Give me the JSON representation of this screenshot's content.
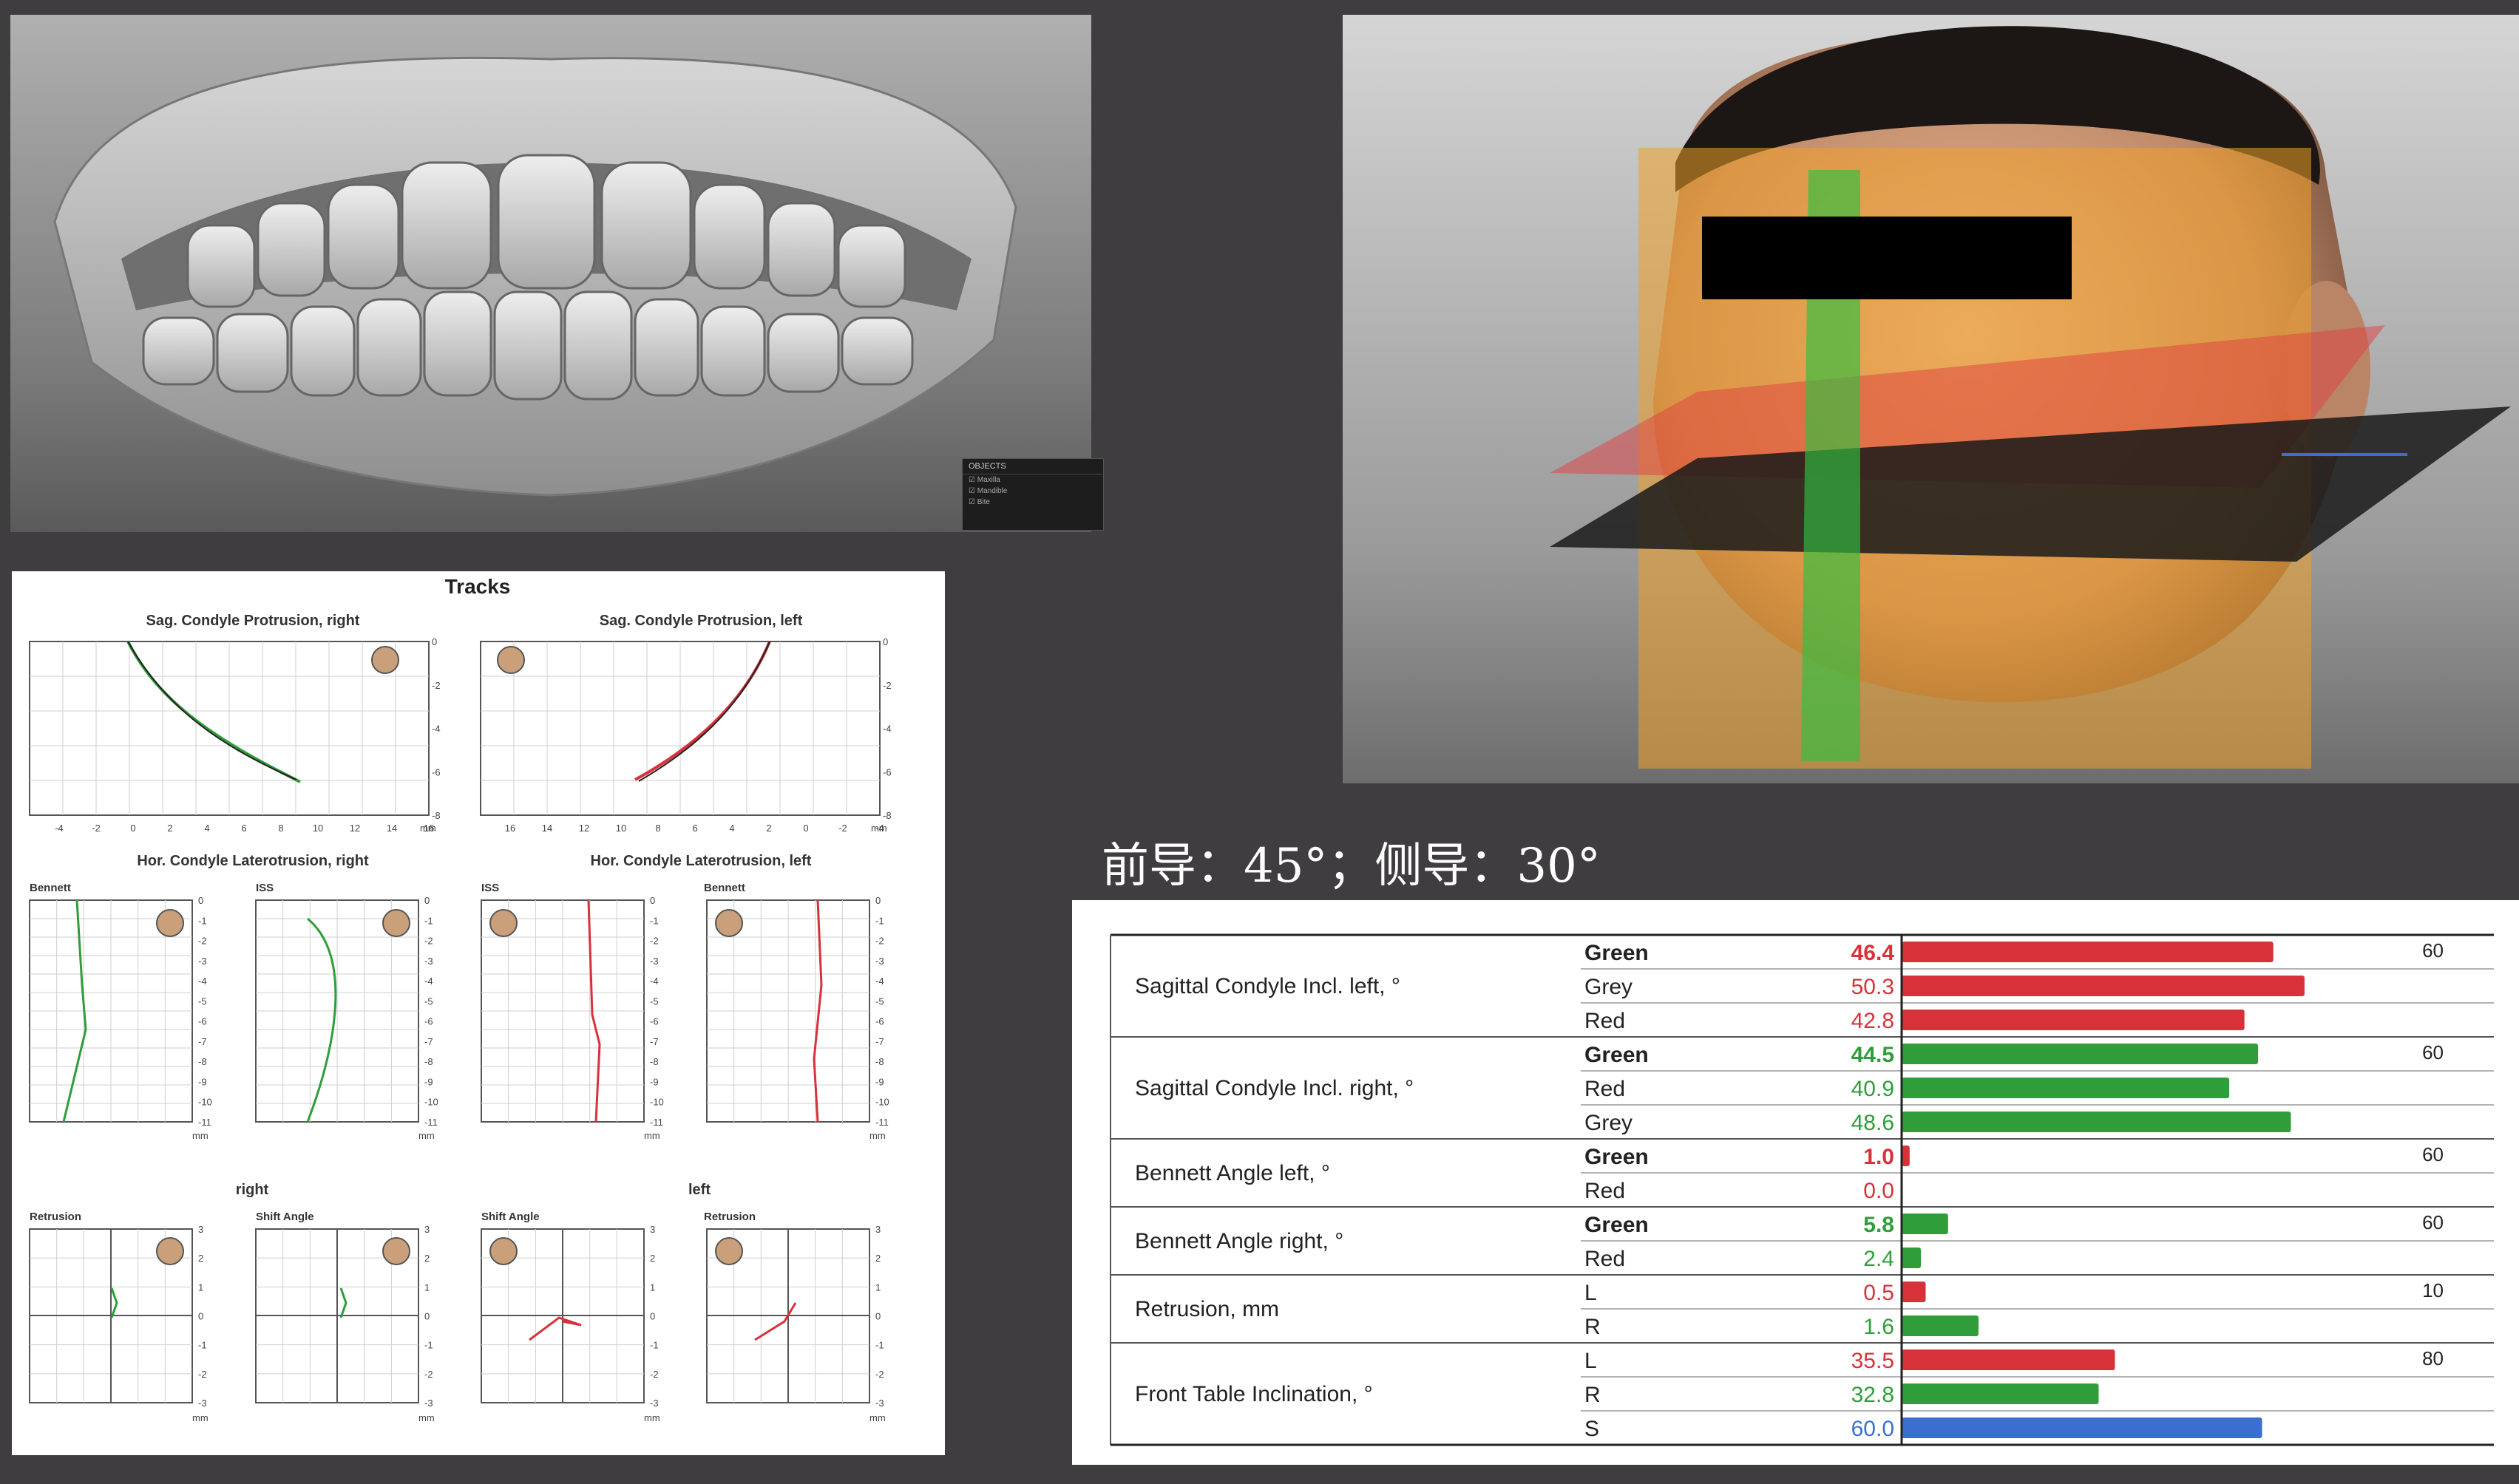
{
  "caption": "前导：45°；侧导：30°",
  "colors": {
    "green": "#2e9d3a",
    "red": "#d7323a",
    "blue": "#3a6fd0",
    "grey_bar": "#d7323a"
  },
  "scene_popup": {
    "title": "OBJECTS",
    "items": [
      "Maxilla",
      "Mandible",
      "Bite"
    ]
  },
  "tracks": {
    "title": "Tracks",
    "sag_right_title": "Sag. Condyle Protrusion, right",
    "sag_left_title": "Sag. Condyle Protrusion, left",
    "sag_right_xticks": [
      "-4",
      "-2",
      "0",
      "2",
      "4",
      "6",
      "8",
      "10",
      "12",
      "14",
      "16"
    ],
    "sag_left_xticks": [
      "16",
      "14",
      "12",
      "10",
      "8",
      "6",
      "4",
      "2",
      "0",
      "-2",
      "-4"
    ],
    "sag_yticks": [
      "0",
      "-2",
      "-4",
      "-6",
      "-8"
    ],
    "unit": "mm",
    "hor_right_title": "Hor. Condyle Laterotrusion, right",
    "hor_left_title": "Hor. Condyle Laterotrusion, left",
    "bennett_label": "Bennett",
    "iss_label": "ISS",
    "hor_yticks": [
      "0",
      "-1",
      "-2",
      "-3",
      "-4",
      "-5",
      "-6",
      "-7",
      "-8",
      "-9",
      "-10",
      "-11"
    ],
    "right_label": "right",
    "left_label": "left",
    "retrusion_label": "Retrusion",
    "shift_label": "Shift Angle",
    "bottom_yticks": [
      "3",
      "2",
      "1",
      "0",
      "-1",
      "-2",
      "-3"
    ]
  },
  "rows": [
    {
      "label": "Sagittal Condyle Incl. left, °",
      "max": "60",
      "scale": 60,
      "entries": [
        {
          "name": "Green",
          "value": "46.4",
          "v": 46.4,
          "text_color": "#d7323a",
          "bar": "#d7323a",
          "bold": true
        },
        {
          "name": "Grey",
          "value": "50.3",
          "v": 50.3,
          "text_color": "#d7323a",
          "bar": "#d7323a",
          "bold": false
        },
        {
          "name": "Red",
          "value": "42.8",
          "v": 42.8,
          "text_color": "#d7323a",
          "bar": "#d7323a",
          "bold": false
        }
      ]
    },
    {
      "label": "Sagittal Condyle Incl. right, °",
      "max": "60",
      "scale": 60,
      "entries": [
        {
          "name": "Green",
          "value": "44.5",
          "v": 44.5,
          "text_color": "#2e9d3a",
          "bar": "#2e9d3a",
          "bold": true
        },
        {
          "name": "Red",
          "value": "40.9",
          "v": 40.9,
          "text_color": "#2e9d3a",
          "bar": "#2e9d3a",
          "bold": false
        },
        {
          "name": "Grey",
          "value": "48.6",
          "v": 48.6,
          "text_color": "#2e9d3a",
          "bar": "#2e9d3a",
          "bold": false
        }
      ]
    },
    {
      "label": "Bennett Angle left, °",
      "max": "60",
      "scale": 60,
      "entries": [
        {
          "name": "Green",
          "value": "1.0",
          "v": 1.0,
          "text_color": "#d7323a",
          "bar": "#d7323a",
          "bold": true
        },
        {
          "name": "Red",
          "value": "0.0",
          "v": 0.0,
          "text_color": "#d7323a",
          "bar": "#d7323a",
          "bold": false
        }
      ]
    },
    {
      "label": "Bennett Angle right, °",
      "max": "60",
      "scale": 60,
      "entries": [
        {
          "name": "Green",
          "value": "5.8",
          "v": 5.8,
          "text_color": "#2e9d3a",
          "bar": "#2e9d3a",
          "bold": true
        },
        {
          "name": "Red",
          "value": "2.4",
          "v": 2.4,
          "text_color": "#2e9d3a",
          "bar": "#2e9d3a",
          "bold": false
        }
      ]
    },
    {
      "label": "Retrusion, mm",
      "max": "10",
      "scale": 10,
      "entries": [
        {
          "name": "L",
          "value": "0.5",
          "v": 0.5,
          "text_color": "#d7323a",
          "bar": "#d7323a",
          "bold": false
        },
        {
          "name": "R",
          "value": "1.6",
          "v": 1.6,
          "text_color": "#2e9d3a",
          "bar": "#2e9d3a",
          "bold": false
        }
      ]
    },
    {
      "label": "Front Table Inclination, °",
      "max": "80",
      "scale": 80,
      "entries": [
        {
          "name": "L",
          "value": "35.5",
          "v": 35.5,
          "text_color": "#d7323a",
          "bar": "#d7323a",
          "bold": false
        },
        {
          "name": "R",
          "value": "32.8",
          "v": 32.8,
          "text_color": "#2e9d3a",
          "bar": "#2e9d3a",
          "bold": false
        },
        {
          "name": "S",
          "value": "60.0",
          "v": 60.0,
          "text_color": "#3a6fd0",
          "bar": "#3a6fd0",
          "bold": false
        }
      ]
    }
  ]
}
